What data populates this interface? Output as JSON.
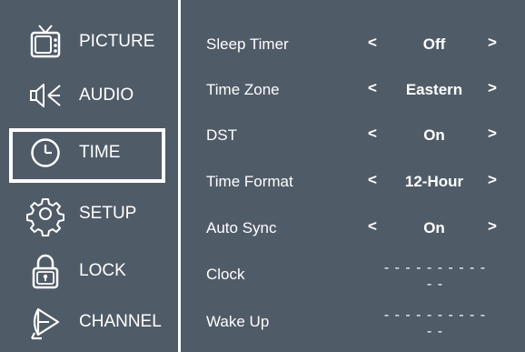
{
  "menu": {
    "items": [
      {
        "label": "PICTURE",
        "icon": "tv-icon"
      },
      {
        "label": "AUDIO",
        "icon": "speaker-icon"
      },
      {
        "label": "TIME",
        "icon": "clock-icon"
      },
      {
        "label": "SETUP",
        "icon": "gear-icon"
      },
      {
        "label": "LOCK",
        "icon": "padlock-icon"
      },
      {
        "label": "CHANNEL",
        "icon": "antenna-icon"
      }
    ],
    "selected": "TIME"
  },
  "settings": {
    "rows": [
      {
        "name": "Sleep Timer",
        "value": "Off"
      },
      {
        "name": "Time Zone",
        "value": "Eastern"
      },
      {
        "name": "DST",
        "value": "On"
      },
      {
        "name": "Time Format",
        "value": "12-Hour"
      },
      {
        "name": "Auto Sync",
        "value": "On"
      },
      {
        "name": "Clock",
        "value": "- - - - - - - - - - - -"
      },
      {
        "name": "Wake Up",
        "value": "- - - - - - - - - - - -"
      }
    ],
    "arrow_left": "<",
    "arrow_right": ">"
  },
  "colors": {
    "background": "#505b68",
    "foreground": "#ffffff"
  }
}
